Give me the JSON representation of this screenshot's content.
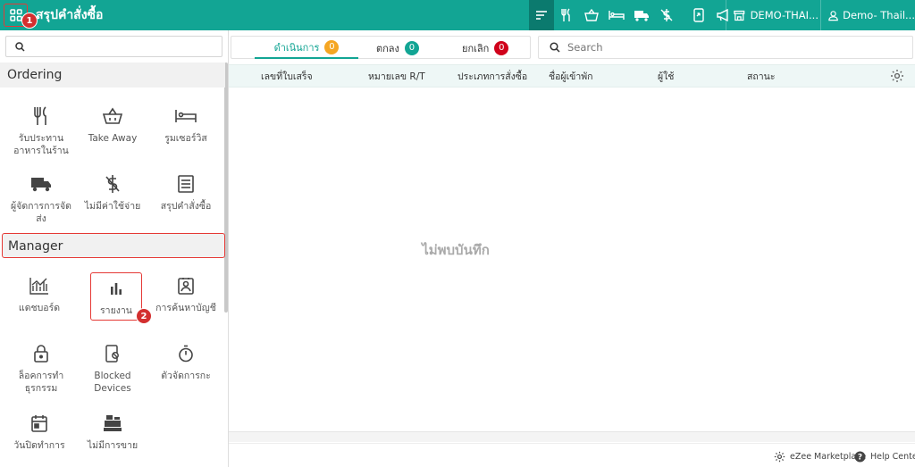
{
  "header": {
    "title": "สรุปคำสั่งซื้อ",
    "step1": "1",
    "outlet": "DEMO-THAI...",
    "user": "Demo- Thail..."
  },
  "sidebar": {
    "search_placeholder": "",
    "step2": "2",
    "sections": [
      {
        "title": "Ordering",
        "items": [
          {
            "label": "รับประทาน\nอาหารในร้าน",
            "icon": "fork-knife-icon"
          },
          {
            "label": "Take Away",
            "icon": "basket-icon"
          },
          {
            "label": "รูมเซอร์วิส",
            "icon": "bed-icon"
          },
          {
            "label": "ผู้จัดการการจัด\nส่ง",
            "icon": "truck-icon"
          },
          {
            "label": "ไม่มีค่าใช้จ่าย",
            "icon": "no-dollar-icon"
          },
          {
            "label": "สรุปคำสั่งซื้อ",
            "icon": "list-doc-icon"
          }
        ]
      },
      {
        "title": "Manager",
        "items": [
          {
            "label": "แดชบอร์ด",
            "icon": "dashboard-chart-icon"
          },
          {
            "label": "รายงาน",
            "icon": "bar-chart-icon"
          },
          {
            "label": "การค้นหาบัญชี",
            "icon": "account-search-icon"
          },
          {
            "label": "ล็อคการทำ\nธุรกรรม",
            "icon": "lock-icon"
          },
          {
            "label": "Blocked\nDevices",
            "icon": "blocked-device-icon"
          },
          {
            "label": "ตัวจัดการกะ",
            "icon": "stopwatch-icon"
          },
          {
            "label": "วันปิดทำการ",
            "icon": "calendar-icon"
          },
          {
            "label": "ไม่มีการขาย",
            "icon": "cash-register-icon"
          }
        ]
      }
    ]
  },
  "main": {
    "tabs": [
      {
        "label": "ดำเนินการ",
        "count": "0",
        "color": "#f5a623"
      },
      {
        "label": "ตกลง",
        "count": "0",
        "color": "#12a594"
      },
      {
        "label": "ยกเลิก",
        "count": "0",
        "color": "#d0021b"
      }
    ],
    "search_placeholder": "Search",
    "columns": [
      "เลขที่ใบเสร็จ",
      "หมายเลข R/T",
      "ประเภทการสั่งซื้อ",
      "ชื่อผู้เข้าพัก",
      "ผู้ใช้",
      "สถานะ"
    ],
    "empty_message": "ไม่พบบันทึก"
  },
  "footer": {
    "marketplace": "eZee Marketplace",
    "help": "Help Center"
  },
  "colors": {
    "brand": "#12a594",
    "brand_dark": "#0b7a6e",
    "highlight": "#e53935"
  }
}
